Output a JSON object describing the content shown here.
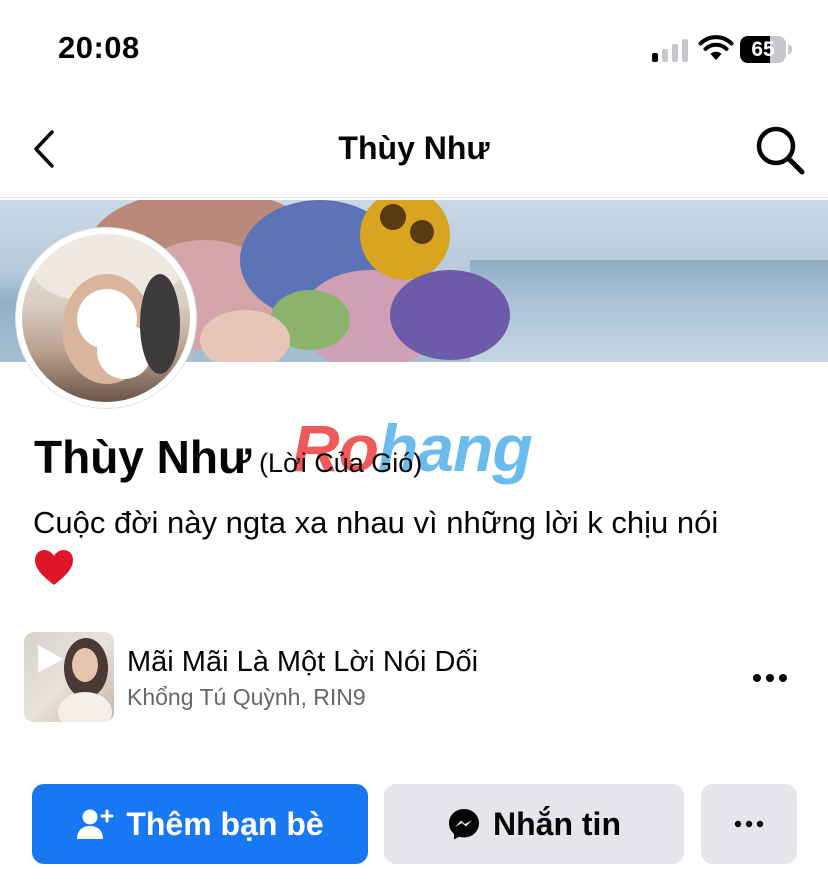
{
  "status_bar": {
    "time": "20:08",
    "battery_percent": "65",
    "battery_level": 0.65,
    "signal_bars_on": 1,
    "signal_bars_total": 4
  },
  "nav": {
    "title": "Thùy Như",
    "back_icon": "chevron-left-icon",
    "search_icon": "search-icon"
  },
  "profile": {
    "name": "Thùy Như",
    "alternate_name": "(Lời Của Gió)",
    "bio": "Cuộc đời này ngta xa nhau vì những lời k chịu nói"
  },
  "watermark": {
    "part1": "Ro",
    "part2": "hang"
  },
  "music": {
    "song_title": "Mãi Mãi Là Một Lời Nói Dối",
    "artist": "Khổng Tú Quỳnh, RIN9",
    "more_icon": "more-horizontal-icon"
  },
  "actions": {
    "add_friend_label": "Thêm bạn bè",
    "message_label": "Nhắn tin",
    "more_icon": "more-horizontal-icon"
  },
  "colors": {
    "primary_button": "#1877f2",
    "secondary_button": "#e4e6eb",
    "text_primary": "#050505",
    "text_secondary": "#65676b",
    "heart": "#e0142a"
  }
}
